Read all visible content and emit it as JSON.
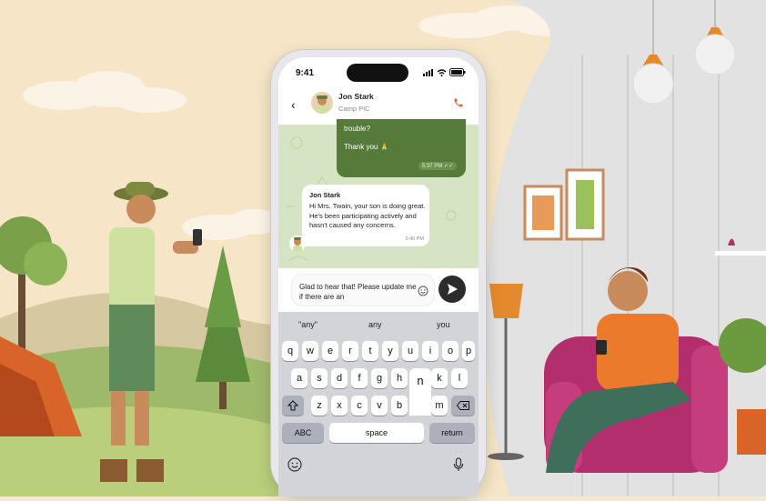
{
  "status": {
    "time": "9:41"
  },
  "contact": {
    "name": "Jon Stark",
    "role": "Camp PIC"
  },
  "messages": {
    "outgoing_line1": "trouble?",
    "outgoing_line2": "Thank you 🙏",
    "outgoing_time": "5:37 PM",
    "incoming_sender": "Jon Stark",
    "incoming_text": "Hi Mrs. Twain, your son is doing great. He's been participating actively and hasn't caused any concerns.",
    "incoming_time": "5:40 PM"
  },
  "composer": {
    "text": "Glad to hear that! Please update me if there are an"
  },
  "suggestions": [
    "\"any\"",
    "any",
    "you"
  ],
  "keyboard": {
    "row1": [
      "q",
      "w",
      "e",
      "r",
      "t",
      "y",
      "u",
      "i",
      "o",
      "p"
    ],
    "row2": [
      "a",
      "s",
      "d",
      "f",
      "g",
      "h",
      "j",
      "k",
      "l"
    ],
    "row3": [
      "z",
      "x",
      "c",
      "v",
      "b",
      "n",
      "m"
    ],
    "popup_key": "n",
    "abc_label": "ABC",
    "space_label": "space",
    "return_label": "return"
  },
  "colors": {
    "accent": "#567a3a",
    "call": "#e2622e"
  }
}
